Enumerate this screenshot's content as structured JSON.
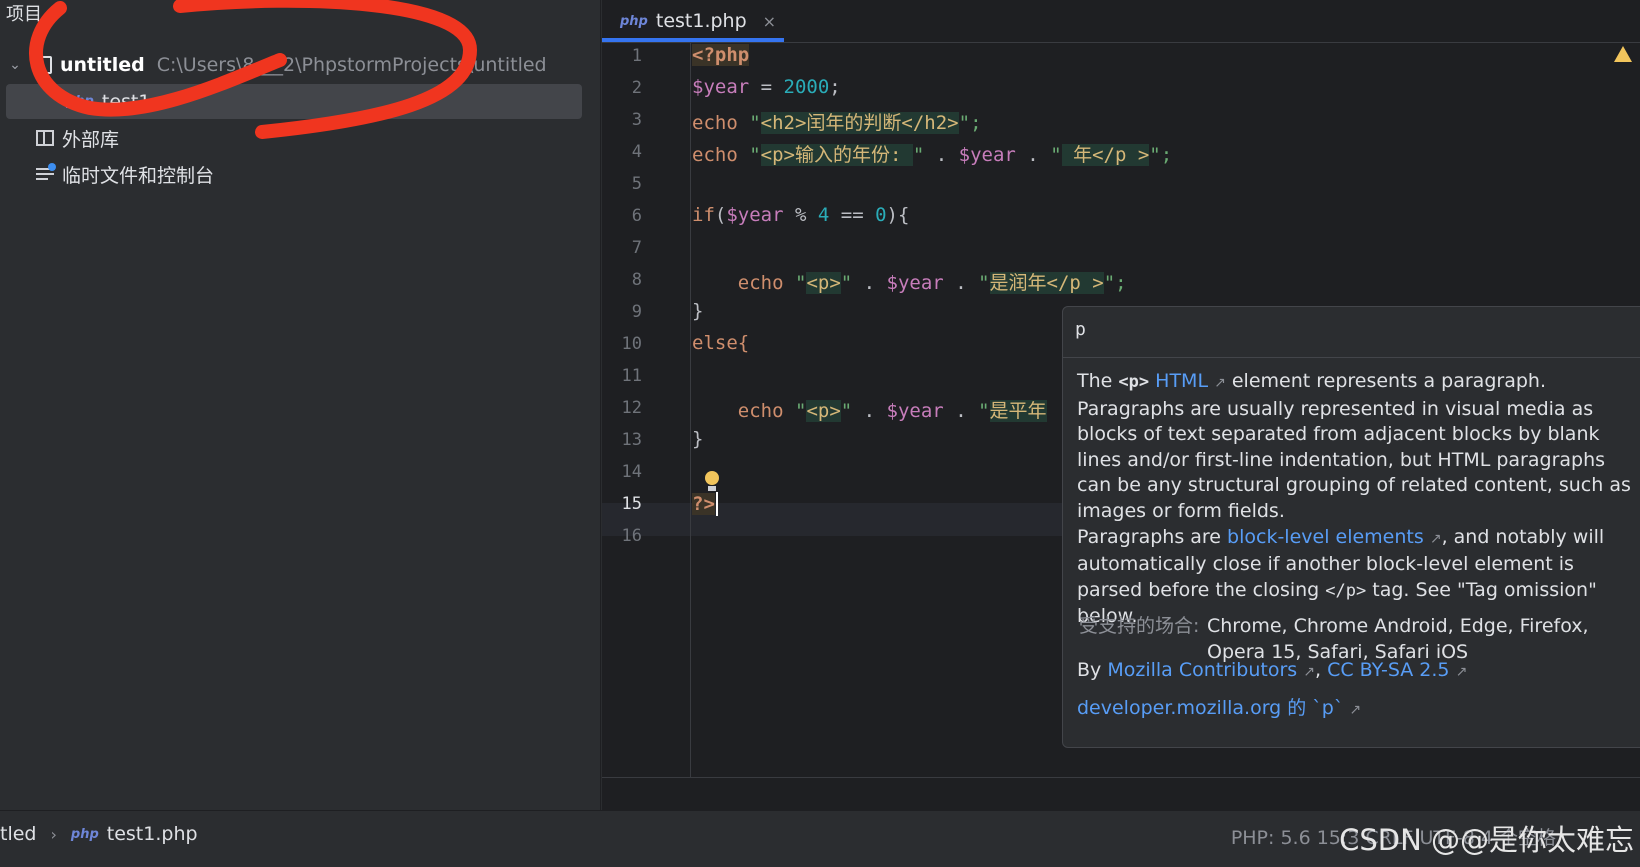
{
  "project_panel": {
    "header": "项目",
    "root_name": "untitled",
    "root_path": "C:\\Users\\8___2\\PhpstormProjects\\untitled",
    "file_badge": "php",
    "file_name": "test1",
    "external_libraries": "外部库",
    "scratches": "临时文件和控制台"
  },
  "editor": {
    "tab": {
      "badge": "php",
      "name": "test1.php",
      "close": "×"
    },
    "line_numbers": [
      "1",
      "2",
      "3",
      "4",
      "5",
      "6",
      "7",
      "8",
      "9",
      "10",
      "11",
      "12",
      "13",
      "14",
      "15",
      "16"
    ],
    "current_line": 15,
    "code": {
      "l1": "<?php",
      "l2_var": "$year",
      "l2_op": " = ",
      "l2_num": "2000",
      "l2_end": ";",
      "l3_kw": "echo",
      "l3_q1": "\"",
      "l3_tag": "<h2>闰年的判断</h2>",
      "l3_q2": "\";",
      "l4_kw": "echo",
      "l4_q1": "\"",
      "l4_tag": "<p>输入的年份: ",
      "l4_q2": "\"",
      "l4_dot1": " . ",
      "l4_var": "$year",
      "l4_dot2": " . ",
      "l4_q3": "\"",
      "l4_tag2": " 年</p >",
      "l4_q4": "\";",
      "l6_kw": "if",
      "l6_p1": "(",
      "l6_var": "$year",
      "l6_op": " % ",
      "l6_num1": "4",
      "l6_eq": " == ",
      "l6_num2": "0",
      "l6_p2": "){",
      "l8_kw": "echo",
      "l8_q1": "\"",
      "l8_tag": "<p>",
      "l8_q2": "\"",
      "l8_dot1": " . ",
      "l8_var": "$year",
      "l8_dot2": " . ",
      "l8_q3": "\"",
      "l8_tag2": "是润年</p >",
      "l8_q4": "\";",
      "l9": "}",
      "l10": "else{",
      "l12_kw": "echo",
      "l12_q1": "\"",
      "l12_tag": "<p>",
      "l12_q2": "\"",
      "l12_dot1": " . ",
      "l12_var": "$year",
      "l12_dot2": " . ",
      "l12_q3": "\"",
      "l12_tag2": "是平年",
      "l13": "}",
      "l15": "?>"
    }
  },
  "doc_popup": {
    "title": "p",
    "p1_pre": "The ",
    "p1_tag": "<p>",
    "p1_link": "HTML",
    "p1_post": " element represents a paragraph. Paragraphs are usually represented in visual media as blocks of text separated from adjacent blocks by blank lines and/or first-line indentation, but HTML paragraphs can be any structural grouping of related content, such as images or form fields.",
    "p2_pre": "Paragraphs are ",
    "p2_link": "block-level elements",
    "p2_mid": ", and notably will automatically close if another block-level element is parsed before the closing ",
    "p2_code": "</p>",
    "p2_post": " tag. See \"Tag omission\" below.",
    "support_label": "受支持的场合:",
    "support_value": "Chrome, Chrome Android, Edge, Firefox, Opera 15, Safari, Safari iOS",
    "by_label": "By ",
    "by_link1": "Mozilla Contributors",
    "by_comma": ", ",
    "by_link2": "CC BY-SA 2.5",
    "mdn_link": "developer.mozilla.org 的 `p`"
  },
  "status_bar": {
    "crumb_project": "tled",
    "crumb_badge": "php",
    "crumb_file": "test1.php",
    "right": "PHP: 5.6   15:3   CRLF   UTF-8   4 个空格",
    "watermark": "CSDN @@是你太难忘"
  },
  "colors": {
    "annotation_red": "#f0351f",
    "accent_blue": "#3574f0",
    "link_blue": "#589df6"
  }
}
